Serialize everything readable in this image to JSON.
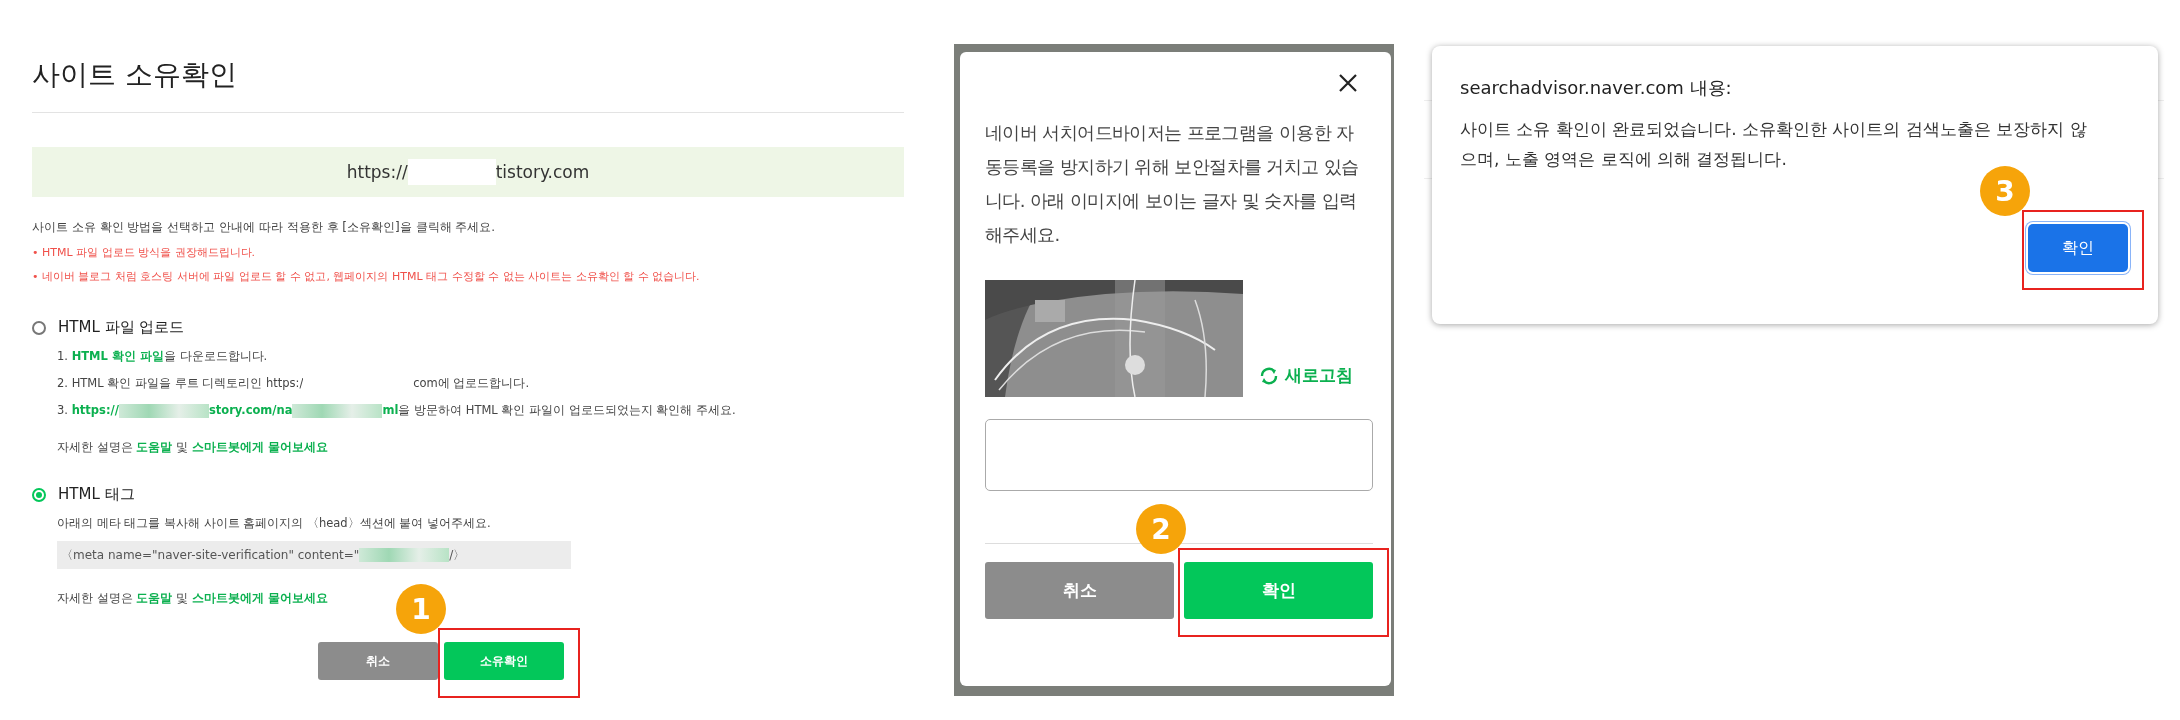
{
  "ownership_page": {
    "title": "사이트 소유확인",
    "site_url": {
      "prefix": "https://",
      "suffix": "tistory.com"
    },
    "instruction": "사이트 소유 확인 방법을 선택하고 안내에 따라 적용한 후 [소유확인]을 클릭해 주세요.",
    "notices": [
      "• HTML 파일 업로드 방식을 권장해드립니다.",
      "• 네이버 블로그 처럼 호스팅 서버에 파일 업로드 할 수 없고, 웹페이지의 HTML 태그 수정할 수 없는 사이트는 소유확인 할 수 없습니다."
    ],
    "methods": [
      {
        "label": "HTML 파일 업로드",
        "selected": false,
        "steps": [
          [
            {
              "kind": "text",
              "text": "1. "
            },
            {
              "kind": "link",
              "text": "HTML 확인 파일"
            },
            {
              "kind": "text",
              "text": "을 다운로드합니다."
            }
          ],
          [
            {
              "kind": "text",
              "text": "2. HTML 확인 파일을 루트 디렉토리인 https:/"
            },
            {
              "kind": "redacted"
            },
            {
              "kind": "text",
              "text": "com에 업로드합니다."
            }
          ],
          [
            {
              "kind": "text",
              "text": "3. "
            },
            {
              "kind": "link",
              "text": "https://"
            },
            {
              "kind": "blurred"
            },
            {
              "kind": "link",
              "text": "story.com/na"
            },
            {
              "kind": "blurred"
            },
            {
              "kind": "link",
              "text": "ml"
            },
            {
              "kind": "text",
              "text": "을 방문하여 HTML 확인 파일이 업로드되었는지 확인해 주세요."
            }
          ]
        ],
        "help": [
          {
            "kind": "text",
            "text": "자세한 설명은 "
          },
          {
            "kind": "link",
            "text": "도움말"
          },
          {
            "kind": "text",
            "text": " 및 "
          },
          {
            "kind": "link",
            "text": "스마트봇에게 물어보세요"
          }
        ]
      },
      {
        "label": "HTML 태그",
        "selected": true,
        "description": "아래의 메타 태그를 복사해 사이트 홈페이지의 〈head〉섹션에 붙여 넣어주세요.",
        "code": [
          {
            "kind": "text",
            "text": "〈meta name=\"naver-site-verification\" content=\""
          },
          {
            "kind": "blurred"
          },
          {
            "kind": "text",
            "text": " /〉"
          }
        ],
        "help": [
          {
            "kind": "text",
            "text": "자세한 설명은 "
          },
          {
            "kind": "link",
            "text": "도움말"
          },
          {
            "kind": "text",
            "text": " 및 "
          },
          {
            "kind": "link",
            "text": "스마트봇에게 물어보세요"
          }
        ]
      }
    ],
    "buttons": [
      {
        "label": "취소",
        "kind": "cancel",
        "highlighted": false
      },
      {
        "label": "소유확인",
        "kind": "primary",
        "highlighted": true,
        "step": "1"
      }
    ]
  },
  "captcha_dialog": {
    "message": "네이버 서치어드바이저는 프로그램을 이용한 자동등록을 방지하기 위해 보안절차를 거치고 있습니다. 아래 이미지에 보이는 글자 및 숫자를 입력해주세요.",
    "refresh": "새로고침",
    "buttons": [
      {
        "label": "취소",
        "kind": "cancel",
        "highlighted": false
      },
      {
        "label": "확인",
        "kind": "primary",
        "highlighted": true,
        "step": "2"
      }
    ]
  },
  "alert_dialog": {
    "title": "searchadvisor.naver.com 내용:",
    "message": "사이트 소유 확인이 완료되었습니다. 소유확인한 사이트의 검색노출은 보장하지 않으며, 노출 영역은 로직에 의해 결정됩니다.",
    "buttons": [
      {
        "label": "확인",
        "kind": "chrome",
        "highlighted": true,
        "step": "3"
      }
    ]
  }
}
